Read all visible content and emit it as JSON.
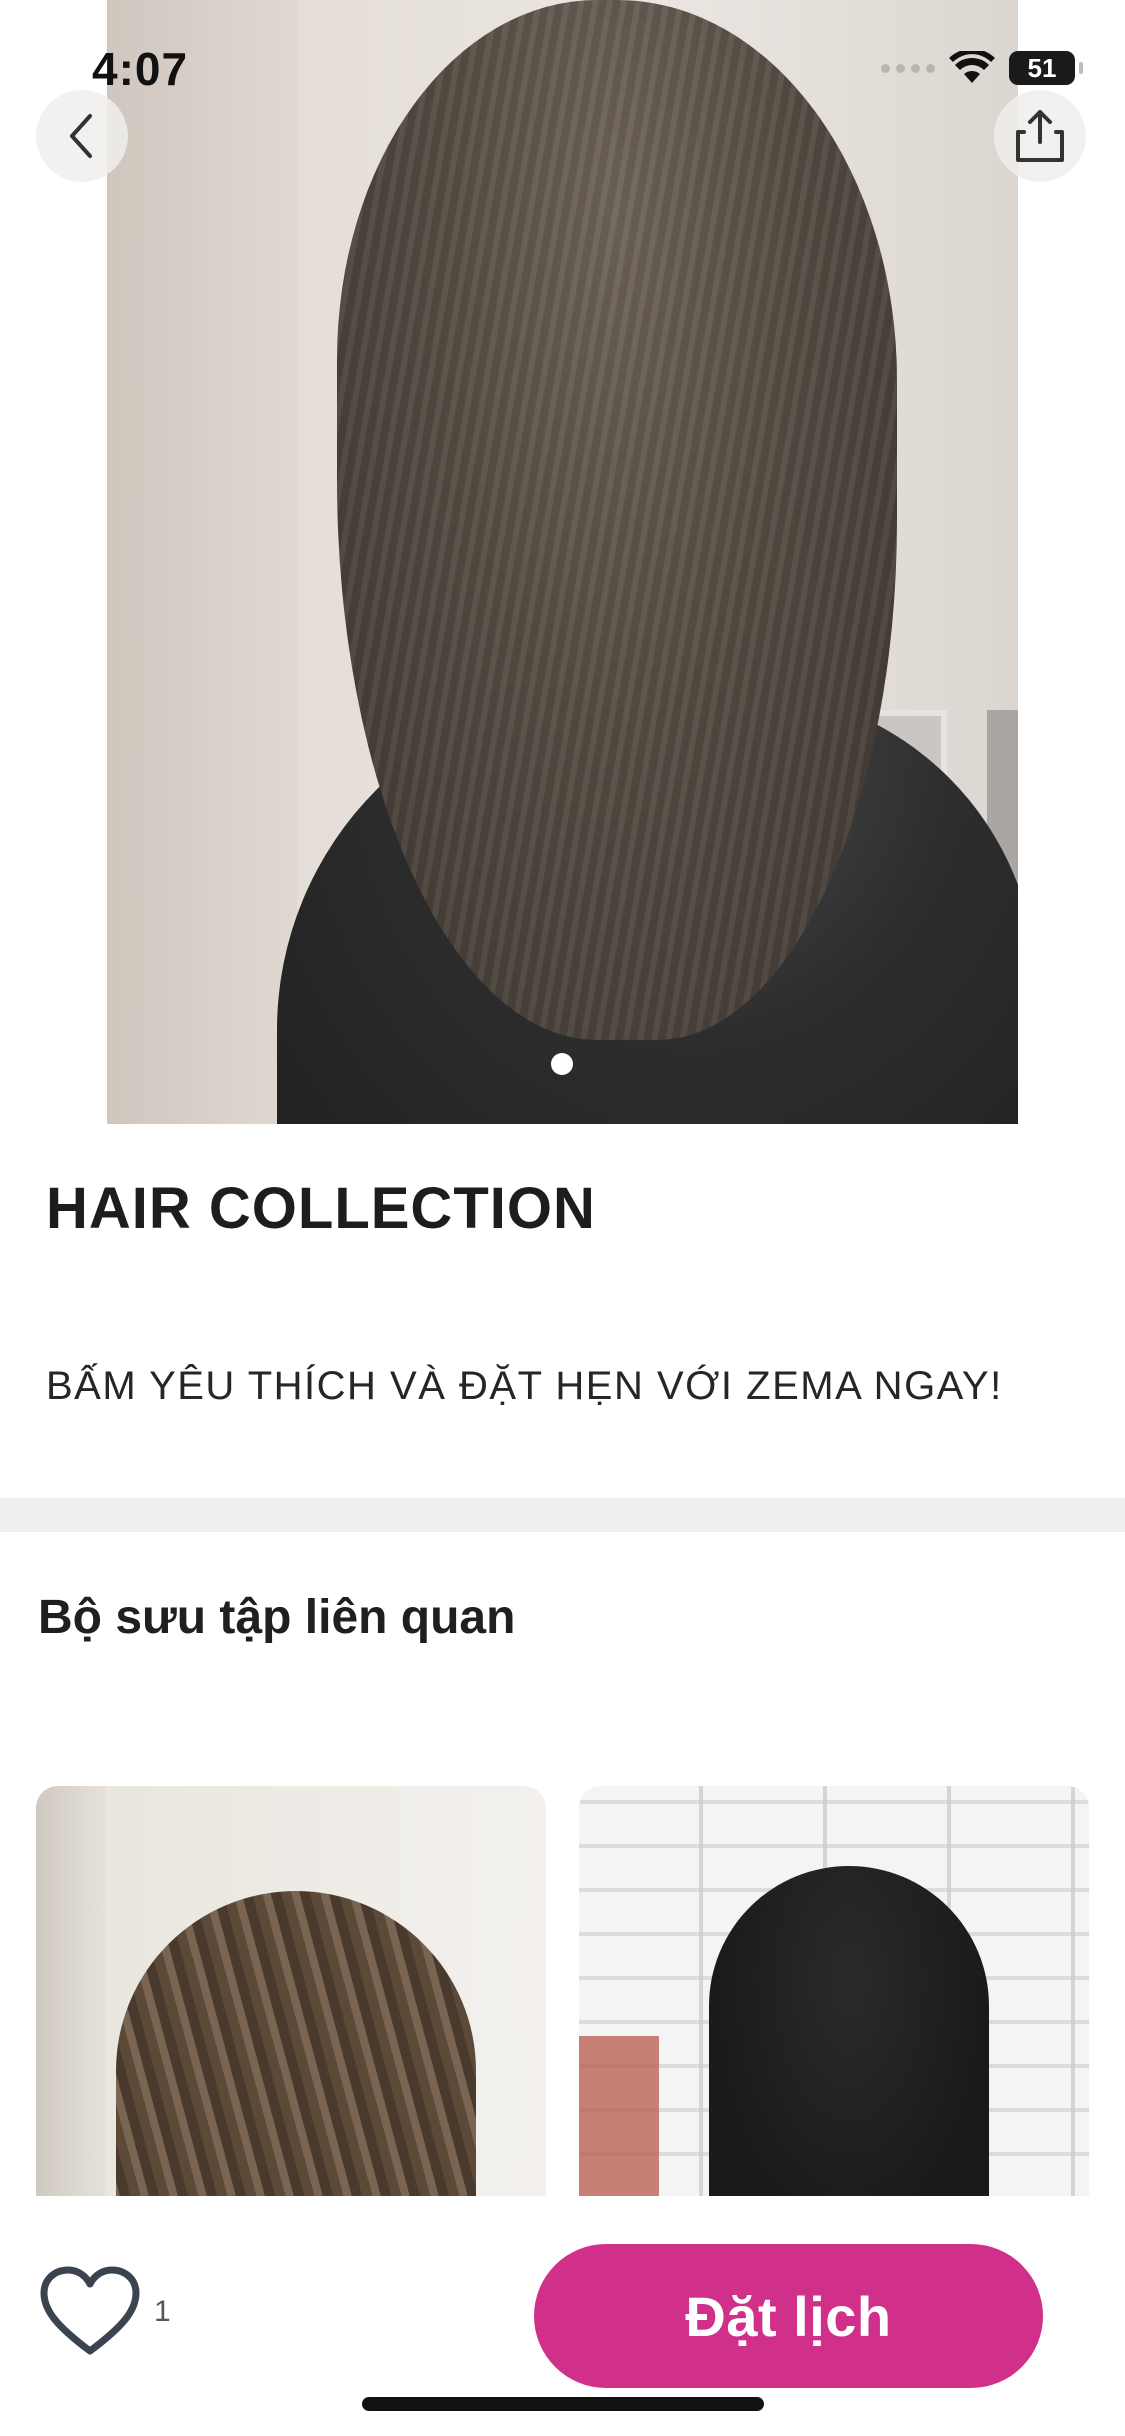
{
  "status_bar": {
    "time": "4:07",
    "battery": "51",
    "icons": [
      "signal-dots-icon",
      "wifi-icon",
      "battery-icon"
    ]
  },
  "nav": {
    "back_icon": "chevron-left-icon",
    "share_icon": "share-icon"
  },
  "carousel": {
    "current_page": 1,
    "total_pages": 1
  },
  "collection": {
    "title": "HAIR COLLECTION",
    "description": "BẤM YÊU THÍCH VÀ ĐẶT HẸN VỚI ZEMA NGAY!"
  },
  "related": {
    "title": "Bộ sưu tập liên quan",
    "cards": [
      {
        "image": "wavy-brown-hair-photo"
      },
      {
        "image": "dark-wavy-hair-photo"
      }
    ]
  },
  "bottom_bar": {
    "like_icon": "heart-icon",
    "like_count": "1",
    "book_label": "Đặt lịch"
  },
  "colors": {
    "accent": "#d1308a",
    "divider": "#efefef",
    "text": "#1c1c1c"
  }
}
